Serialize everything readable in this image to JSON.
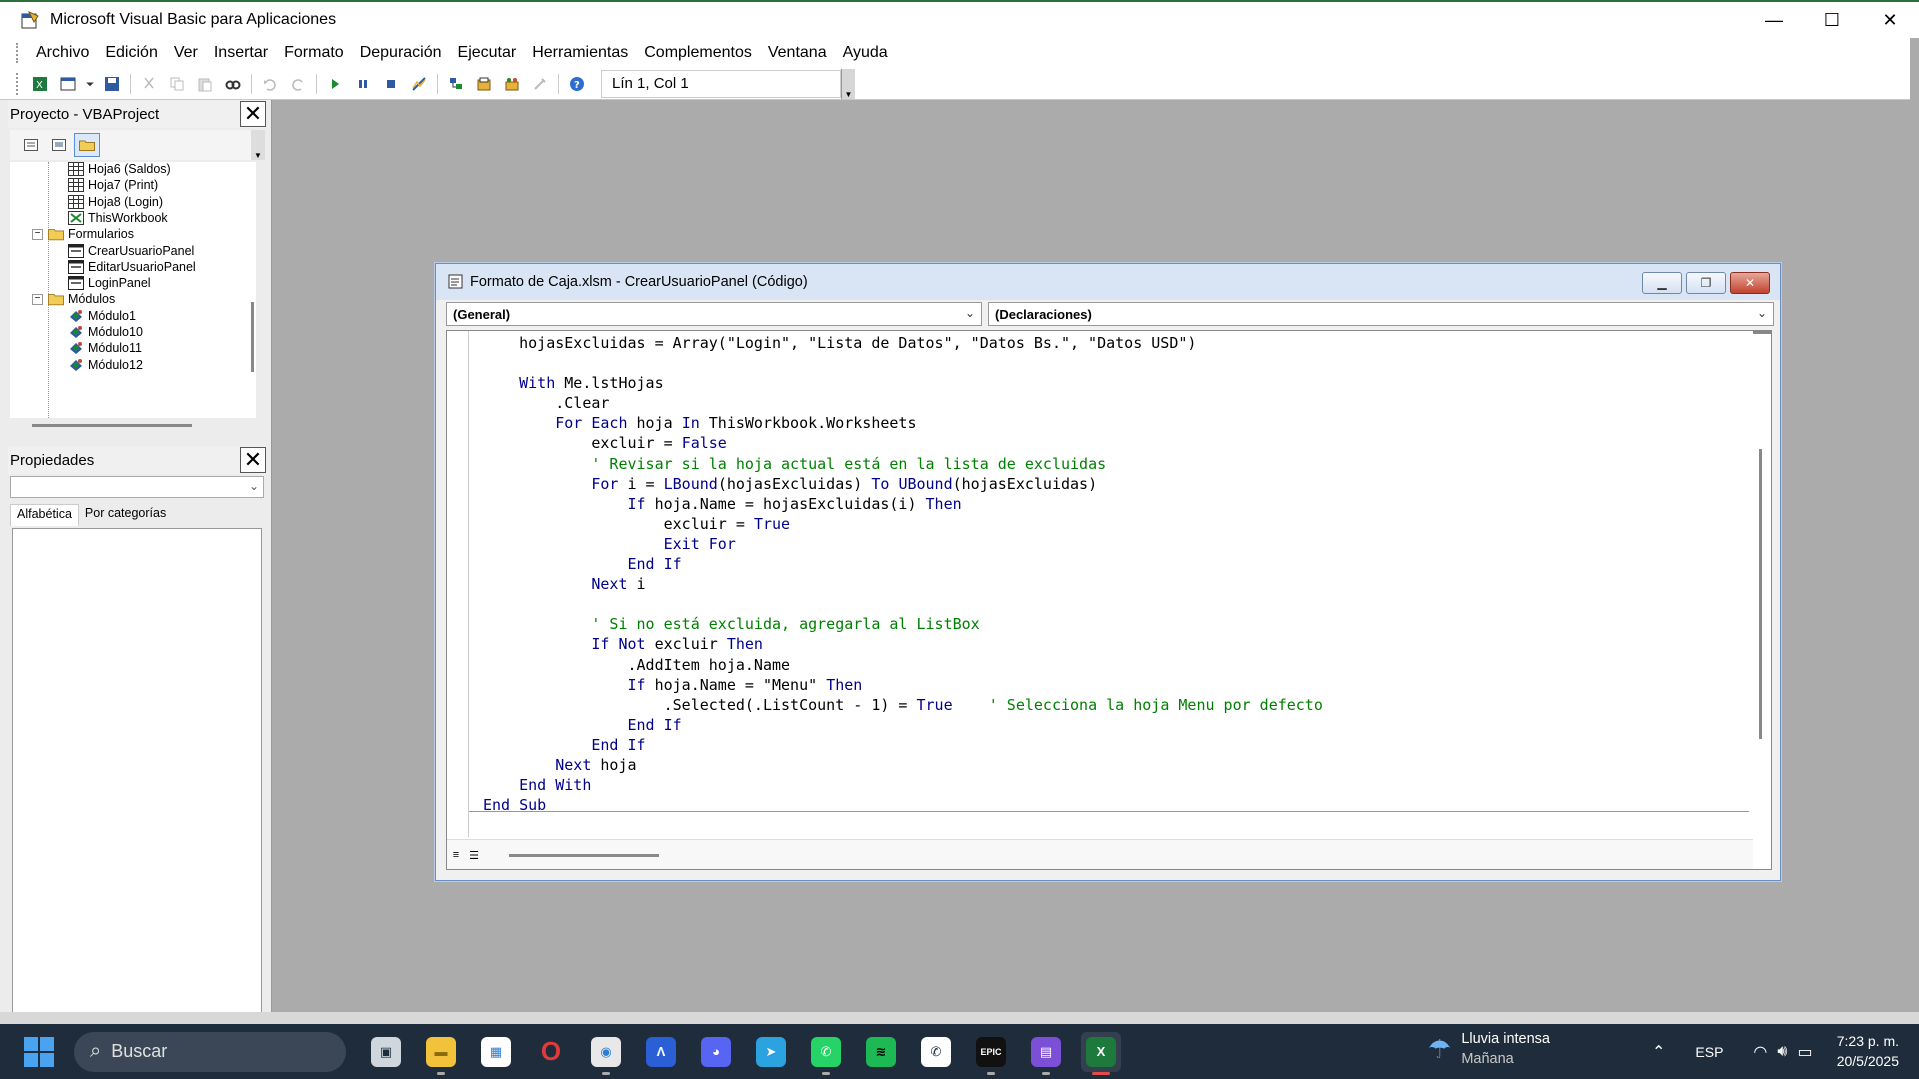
{
  "window": {
    "title": "Microsoft Visual Basic para Aplicaciones",
    "minimize": "—",
    "maximize": "☐",
    "close": "✕"
  },
  "menu": [
    "Archivo",
    "Edición",
    "Ver",
    "Insertar",
    "Formato",
    "Depuración",
    "Ejecutar",
    "Herramientas",
    "Complementos",
    "Ventana",
    "Ayuda"
  ],
  "toolbar": {
    "position": "Lín 1, Col 1"
  },
  "project": {
    "title": "Proyecto - VBAProject",
    "tree": [
      {
        "label": "Hoja6 (Saldos)",
        "icon": "sheet-icon"
      },
      {
        "label": "Hoja7 (Print)",
        "icon": "sheet-icon"
      },
      {
        "label": "Hoja8 (Login)",
        "icon": "sheet-icon"
      },
      {
        "label": "ThisWorkbook",
        "icon": "workbook-icon"
      },
      {
        "label": "Formularios",
        "icon": "folder-icon"
      },
      {
        "label": "CrearUsuarioPanel",
        "icon": "form-icon"
      },
      {
        "label": "EditarUsuarioPanel",
        "icon": "form-icon"
      },
      {
        "label": "LoginPanel",
        "icon": "form-icon"
      },
      {
        "label": "Módulos",
        "icon": "folder-icon"
      },
      {
        "label": "Módulo1",
        "icon": "module-icon"
      },
      {
        "label": "Módulo10",
        "icon": "module-icon"
      },
      {
        "label": "Módulo11",
        "icon": "module-icon"
      },
      {
        "label": "Módulo12",
        "icon": "module-icon"
      }
    ]
  },
  "properties": {
    "title": "Propiedades",
    "tabs": [
      "Alfabética",
      "Por categorías"
    ]
  },
  "codewindow": {
    "title": "Formato de Caja.xlsm - CrearUsuarioPanel (Código)",
    "object_combo": "(General)",
    "proc_combo": "(Declaraciones)",
    "lines": [
      [
        [
          "    hojasExcluidas = Array(\"Login\", \"Lista de Datos\", \"Datos Bs.\", \"Datos USD\")",
          "t"
        ]
      ],
      [
        [
          "",
          "t"
        ]
      ],
      [
        [
          "    ",
          "t"
        ],
        [
          "With",
          "k"
        ],
        [
          " Me.lstHojas",
          "t"
        ]
      ],
      [
        [
          "        .Clear",
          "t"
        ]
      ],
      [
        [
          "        ",
          "t"
        ],
        [
          "For Each",
          "k"
        ],
        [
          " hoja ",
          "t"
        ],
        [
          "In",
          "k"
        ],
        [
          " ThisWorkbook.Worksheets",
          "t"
        ]
      ],
      [
        [
          "            excluir = ",
          "t"
        ],
        [
          "False",
          "k"
        ]
      ],
      [
        [
          "            ",
          "t"
        ],
        [
          "' Revisar si la hoja actual está en la lista de excluidas",
          "c"
        ]
      ],
      [
        [
          "            ",
          "t"
        ],
        [
          "For",
          "k"
        ],
        [
          " i = ",
          "t"
        ],
        [
          "LBound",
          "k"
        ],
        [
          "(hojasExcluidas) ",
          "t"
        ],
        [
          "To",
          "k"
        ],
        [
          " ",
          "t"
        ],
        [
          "UBound",
          "k"
        ],
        [
          "(hojasExcluidas)",
          "t"
        ]
      ],
      [
        [
          "                ",
          "t"
        ],
        [
          "If",
          "k"
        ],
        [
          " hoja.Name = hojasExcluidas(i) ",
          "t"
        ],
        [
          "Then",
          "k"
        ]
      ],
      [
        [
          "                    excluir = ",
          "t"
        ],
        [
          "True",
          "k"
        ]
      ],
      [
        [
          "                    ",
          "t"
        ],
        [
          "Exit For",
          "k"
        ]
      ],
      [
        [
          "                ",
          "t"
        ],
        [
          "End If",
          "k"
        ]
      ],
      [
        [
          "            ",
          "t"
        ],
        [
          "Next",
          "k"
        ],
        [
          " i",
          "t"
        ]
      ],
      [
        [
          "",
          "t"
        ]
      ],
      [
        [
          "            ",
          "t"
        ],
        [
          "' Si no está excluida, agregarla al ListBox",
          "c"
        ]
      ],
      [
        [
          "            ",
          "t"
        ],
        [
          "If Not",
          "k"
        ],
        [
          " excluir ",
          "t"
        ],
        [
          "Then",
          "k"
        ]
      ],
      [
        [
          "                .AddItem hoja.Name",
          "t"
        ]
      ],
      [
        [
          "                ",
          "t"
        ],
        [
          "If",
          "k"
        ],
        [
          " hoja.Name = \"Menu\" ",
          "t"
        ],
        [
          "Then",
          "k"
        ]
      ],
      [
        [
          "                    .Selected(.ListCount - 1) = ",
          "t"
        ],
        [
          "True",
          "k"
        ],
        [
          "    ",
          "t"
        ],
        [
          "' Selecciona la hoja Menu por defecto",
          "c"
        ]
      ],
      [
        [
          "                ",
          "t"
        ],
        [
          "End If",
          "k"
        ]
      ],
      [
        [
          "            ",
          "t"
        ],
        [
          "End If",
          "k"
        ]
      ],
      [
        [
          "        ",
          "t"
        ],
        [
          "Next",
          "k"
        ],
        [
          " hoja",
          "t"
        ]
      ],
      [
        [
          "    ",
          "t"
        ],
        [
          "End With",
          "k"
        ]
      ],
      [
        [
          "End Sub",
          "k"
        ]
      ]
    ]
  },
  "taskbar": {
    "search_placeholder": "Buscar",
    "weather_title": "Lluvia intensa",
    "weather_sub": "Mañana",
    "lang": "ESP",
    "time": "7:23 p. m.",
    "date": "20/5/2025",
    "apps": [
      "task-view-icon",
      "file-explorer-icon",
      "store-icon",
      "opera-icon",
      "chrome-icon",
      "vscode-icon",
      "discord-icon",
      "telegram-icon",
      "whatsapp-icon",
      "spotify-icon",
      "whatsapp-business-icon",
      "epic-games-icon",
      "clipchamp-icon",
      "excel-icon"
    ]
  },
  "colors": {
    "keyword": "#00008b",
    "comment": "#008000",
    "taskbar": "#1f2c3b"
  }
}
